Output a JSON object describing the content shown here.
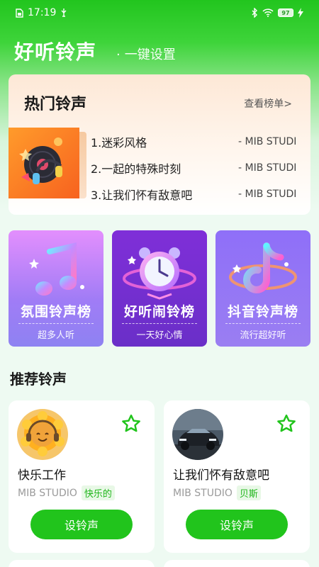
{
  "status_bar": {
    "time": "17:19",
    "battery": "97"
  },
  "header": {
    "title": "好听铃声",
    "subtitle": "一键设置"
  },
  "hot": {
    "title": "热门铃声",
    "more_label": "查看榜单>",
    "items": [
      {
        "name": "1.迷彩风格",
        "artist": "- MIB STUDIO"
      },
      {
        "name": "2.一起的特殊时刻",
        "artist": "- MIB STUDIO"
      },
      {
        "name": "3.让我们怀有敌意吧",
        "artist": "- MIB STUDIO"
      }
    ]
  },
  "categories": [
    {
      "title": "氛围铃声榜",
      "subtitle": "超多人听",
      "icon": "music-note-icon"
    },
    {
      "title": "好听闹铃榜",
      "subtitle": "一天好心情",
      "icon": "alarm-clock-icon"
    },
    {
      "title": "抖音铃声榜",
      "subtitle": "流行超好听",
      "icon": "tiktok-note-icon"
    }
  ],
  "recommend": {
    "title": "推荐铃声",
    "items": [
      {
        "name": "快乐工作",
        "artist": "MIB STUDIO",
        "tag": "快乐的",
        "button": "设铃声",
        "avatar": "sunflower-headphones-avatar"
      },
      {
        "name": "让我们怀有敌意吧",
        "artist": "MIB STUDIO",
        "tag": "贝斯",
        "button": "设铃声",
        "avatar": "car-avatar"
      }
    ]
  },
  "colors": {
    "brand_green": "#21c41c",
    "tag_green": "#1fb61a"
  }
}
